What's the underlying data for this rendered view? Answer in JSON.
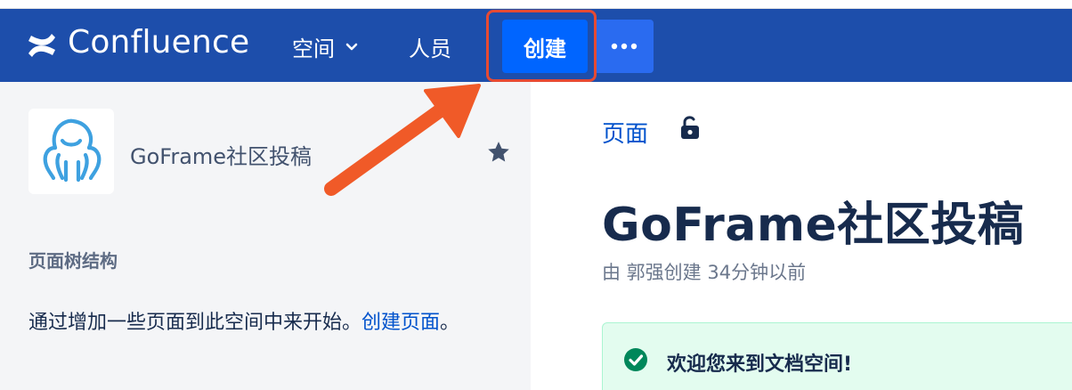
{
  "header": {
    "logo_text": "Confluence",
    "nav_spaces_label": "空间",
    "nav_people_label": "人员",
    "create_label": "创建",
    "more_icon": "more-horizontal-icon",
    "brand_color": "#1d4eab",
    "create_color": "#0065ff"
  },
  "sidebar": {
    "space_name": "GoFrame社区投稿",
    "tree_heading": "页面树结构",
    "empty_message_prefix": "通过增加一些页面到此空间中来开始。",
    "empty_message_link": "创建页面",
    "empty_message_suffix": "。",
    "star_icon": "star-icon"
  },
  "main": {
    "breadcrumb": "页面",
    "lock_icon": "unlock-icon",
    "title": "GoFrame社区投稿",
    "byline": "由 郭强创建 34分钟以前",
    "welcome_text": "欢迎您来到文档空间!",
    "check_icon": "check-circle-icon"
  },
  "annotation": {
    "highlight_color": "#e64a33",
    "arrow_color": "#f05a28"
  }
}
